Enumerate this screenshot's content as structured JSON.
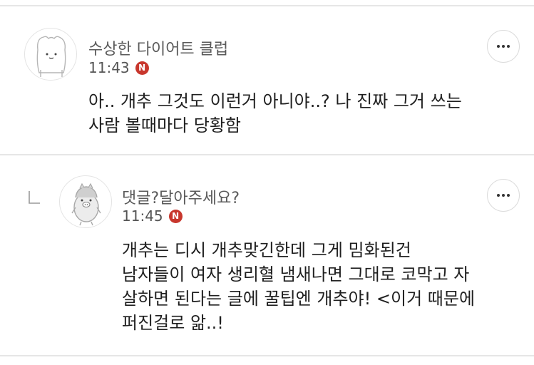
{
  "comments": [
    {
      "nickname": "수상한 다이어트 클럽",
      "time": "11:43",
      "badge": "N",
      "avatar_icon": "bear-avatar-icon",
      "lines": [
        "아.. 개추 그것도 이런거 아니야..? 나 진짜 그거 쓰는",
        "사람 볼때마다 당황함"
      ]
    },
    {
      "nickname": "댓글?달아주세요?",
      "time": "11:45",
      "badge": "N",
      "avatar_icon": "penguin-avatar-icon",
      "is_reply": true,
      "lines": [
        "개추는 디시 개추맞긴한데 그게 밈화된건",
        "남자들이 여자 생리혈 냄새나면 그대로 코막고 자",
        "살하면 된다는 글에 꿀팁엔 개추야! <이거 때문에",
        "퍼진걸로 앎..!"
      ]
    }
  ],
  "colors": {
    "badge": "#c8372d",
    "divider": "#e6e6e6",
    "nickname": "#5a5a5a"
  }
}
